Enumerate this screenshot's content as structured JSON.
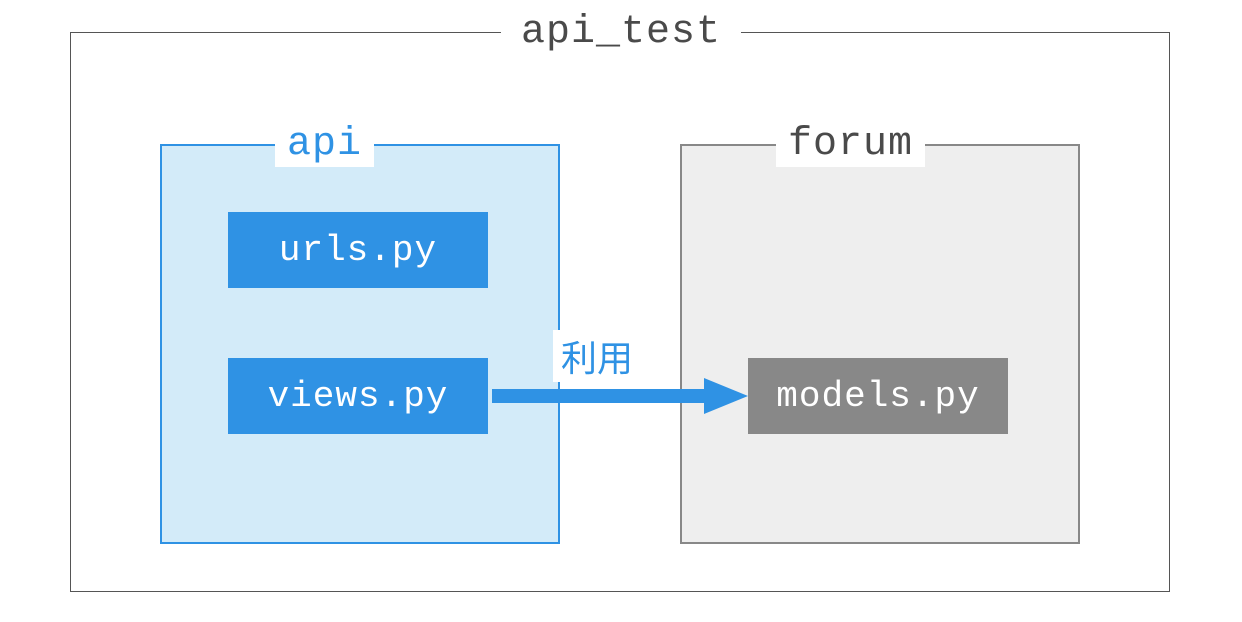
{
  "outer": {
    "label": "api_test"
  },
  "left": {
    "label": "api",
    "files": {
      "urls": "urls.py",
      "views": "views.py"
    }
  },
  "right": {
    "label": "forum",
    "files": {
      "models": "models.py"
    }
  },
  "arrow": {
    "label": "利用"
  }
}
